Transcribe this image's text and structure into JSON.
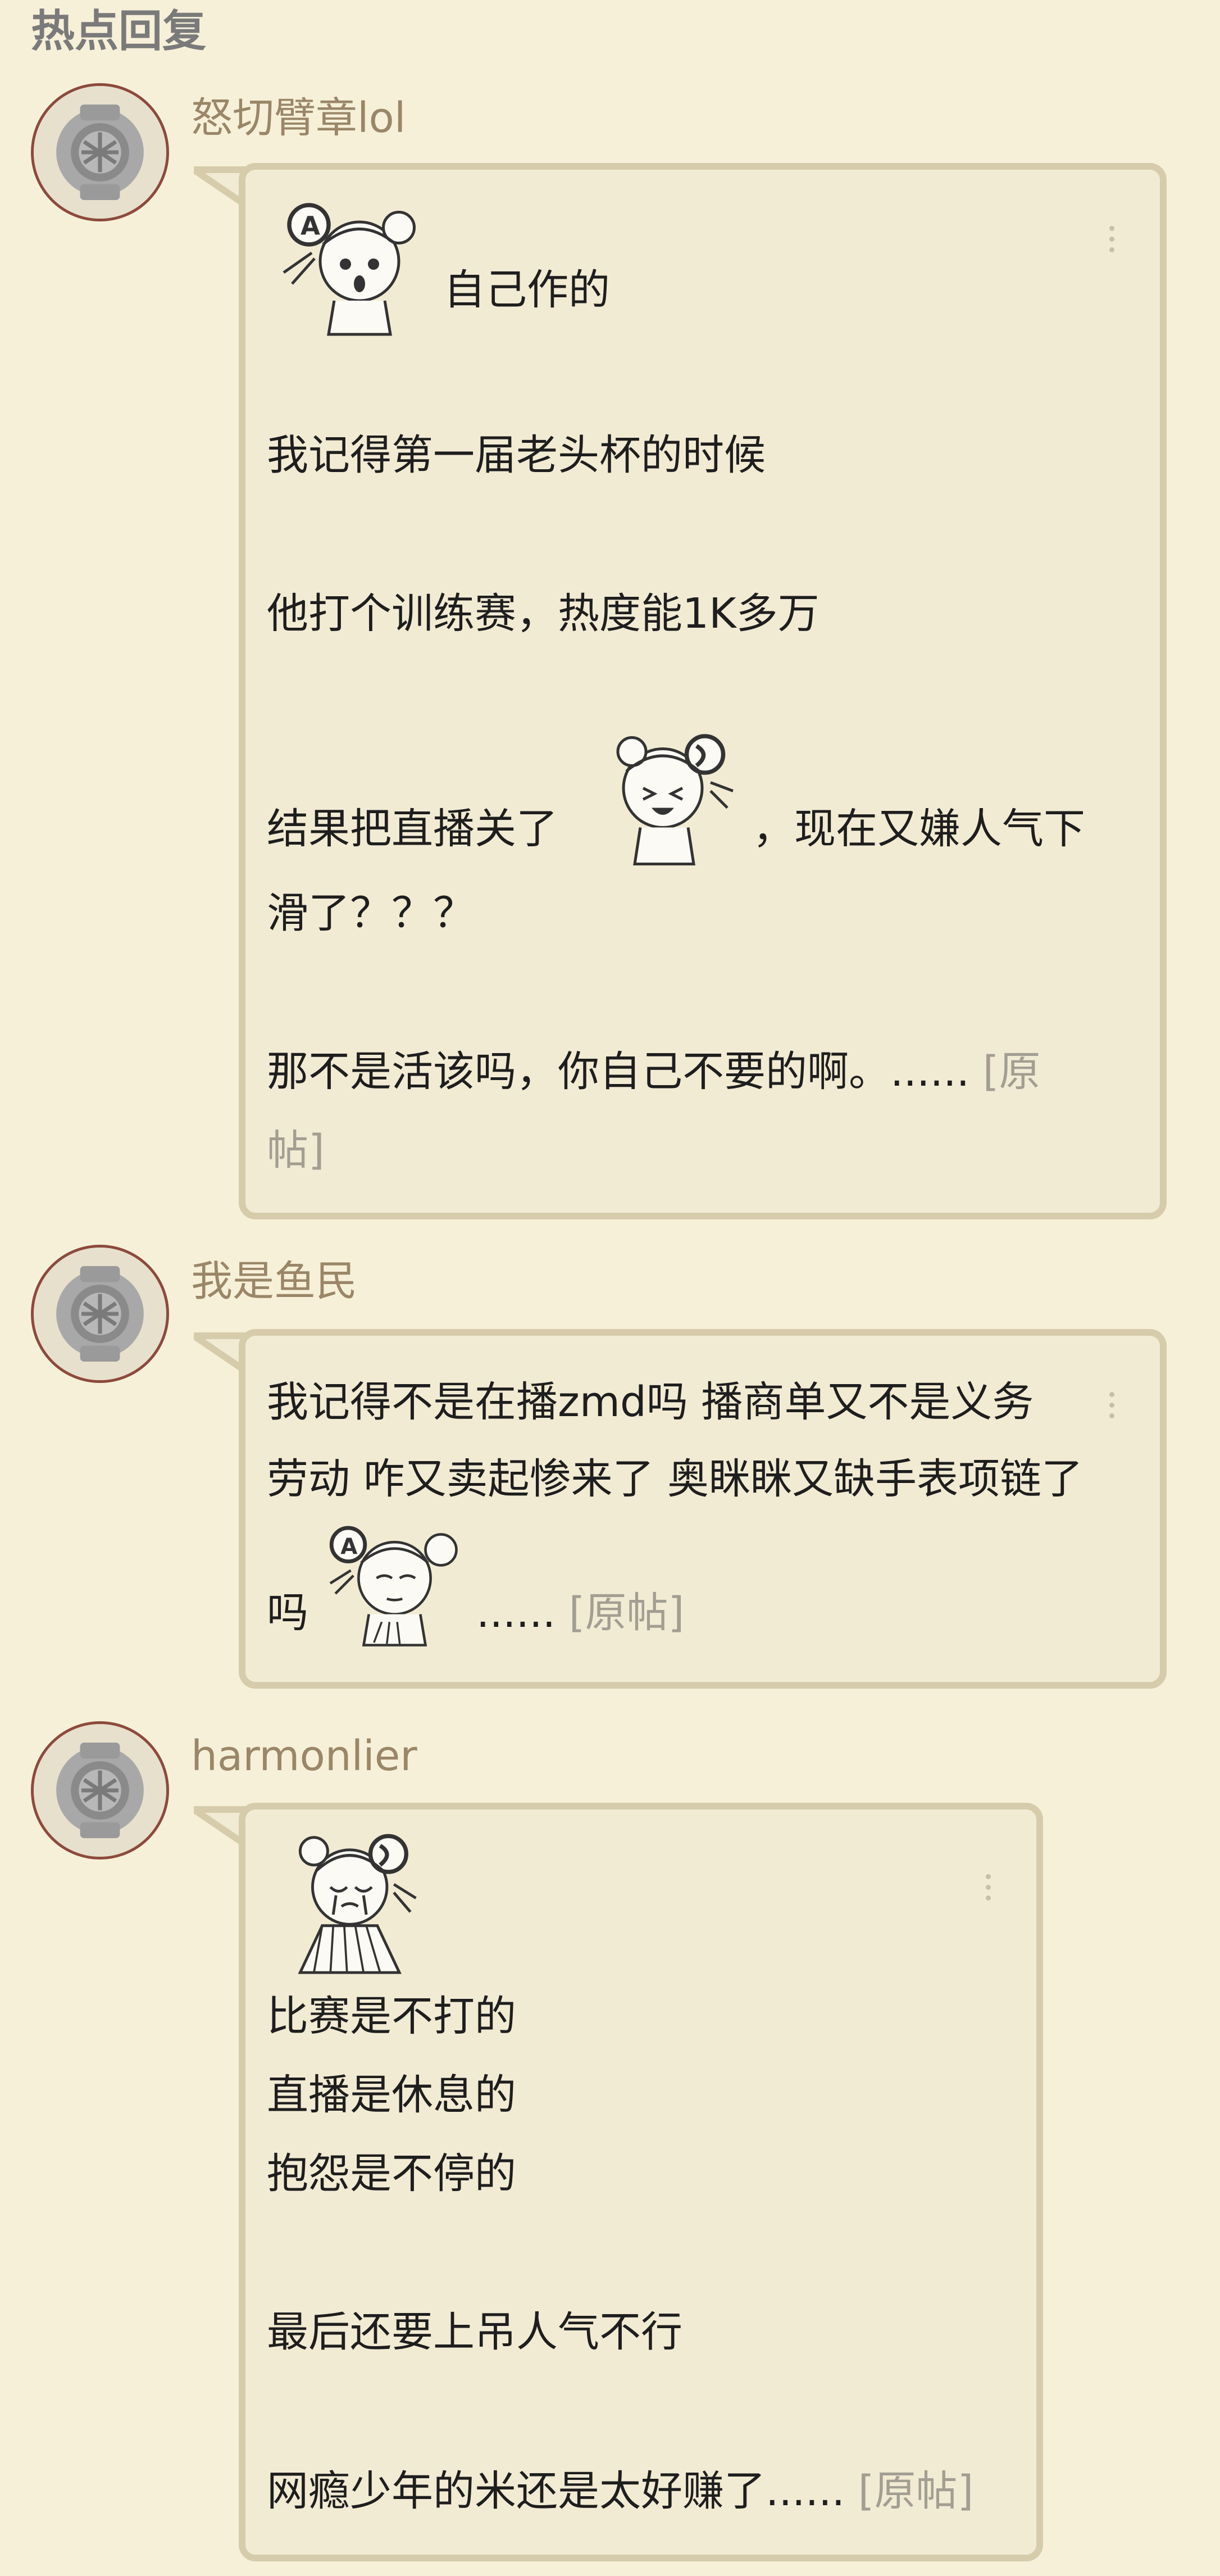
{
  "section": {
    "title": "热点回复"
  },
  "colors": {
    "background": "#f7f0d9",
    "bubble_bg": "#f2ebd4",
    "bubble_border": "#d6ccab",
    "username": "#9a8668",
    "link": "#a39e92"
  },
  "replies": [
    {
      "username": "怒切臂章lol",
      "lines": [
        "自己作的",
        "我记得第一届老头杯的时候",
        "他打个训练赛，热度能1K多万",
        "结果把直播关了",
        "，现在又嫌人气下",
        "滑了？？？",
        "那不是活该吗，你自己不要的啊。......",
        "帖]"
      ],
      "link_open": "[原",
      "stickers": [
        "anime-girl-surprised-sticker",
        "anime-girl-laughing-sticker"
      ]
    },
    {
      "username": "我是鱼民",
      "lines": [
        "我记得不是在播zmd吗 播商单又不是义务",
        "劳动 咋又卖起惨来了 奥眯眯又缺手表项链了",
        "吗",
        "......"
      ],
      "link": "[原帖]",
      "stickers": [
        "anime-girl-fan-sticker"
      ]
    },
    {
      "username": "harmonlier",
      "lines": [
        "比赛是不打的",
        "直播是休息的",
        "抱怨是不停的",
        "最后还要上吊人气不行",
        "网瘾少年的米还是太好赚了......"
      ],
      "link": "[原帖]",
      "stickers": [
        "anime-girl-crying-sticker"
      ]
    }
  ]
}
